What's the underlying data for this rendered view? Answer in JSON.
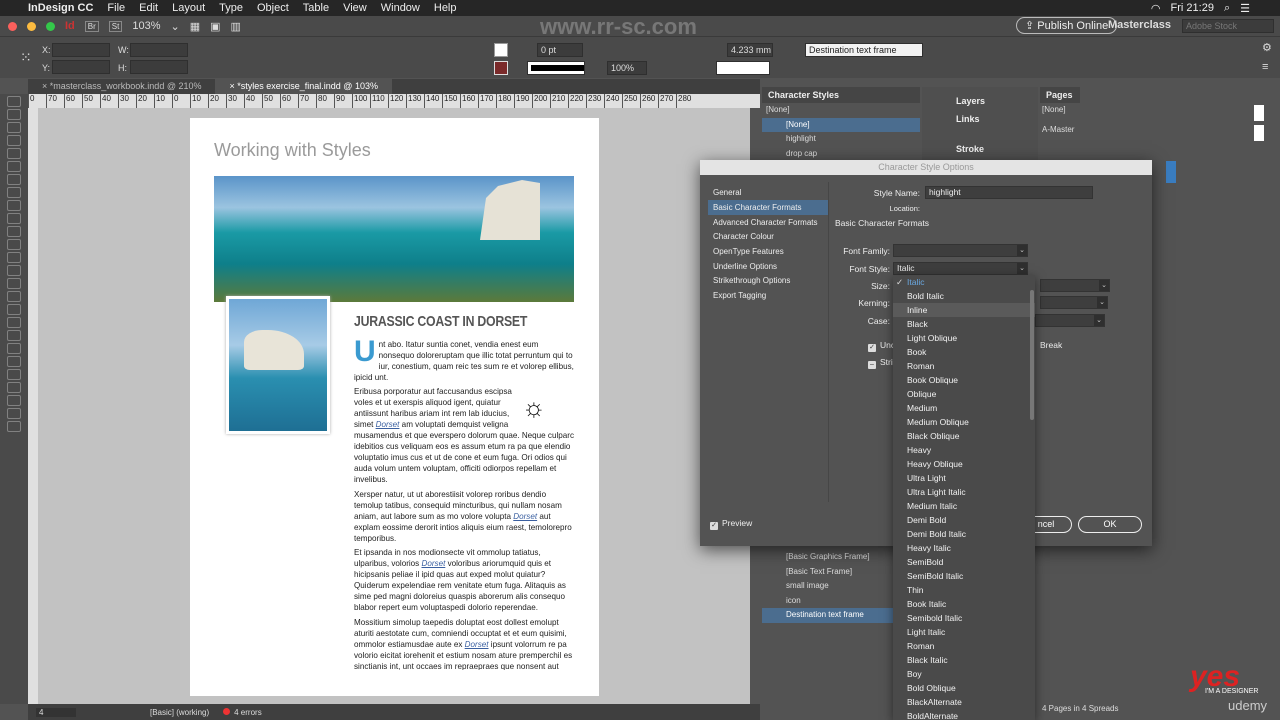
{
  "menubar": {
    "app": "InDesign CC",
    "items": [
      "File",
      "Edit",
      "Layout",
      "Type",
      "Object",
      "Table",
      "View",
      "Window",
      "Help"
    ],
    "clock": "Fri 21:29"
  },
  "appbar": {
    "zoom": "103%",
    "publish": "Publish Online",
    "workspace": "Masterclass",
    "stock_placeholder": "Adobe Stock"
  },
  "control": {
    "x_label": "X:",
    "y_label": "Y:",
    "w_label": "W:",
    "h_label": "H:",
    "stroke_weight": "0 pt",
    "opacity": "100%",
    "spacing": "4.233 mm",
    "object_style": "Destination text frame"
  },
  "tabs": [
    {
      "label": "*masterclass_workbook.indd @ 210%"
    },
    {
      "label": "*styles exercise_final.indd @ 103%"
    }
  ],
  "ruler": [
    "0",
    "70",
    "60",
    "50",
    "40",
    "30",
    "20",
    "10",
    "0",
    "10",
    "20",
    "30",
    "40",
    "50",
    "60",
    "70",
    "80",
    "90",
    "100",
    "110",
    "120",
    "130",
    "140",
    "150",
    "160",
    "170",
    "180",
    "190",
    "200",
    "210",
    "220",
    "230",
    "240",
    "250",
    "260",
    "270",
    "280"
  ],
  "document": {
    "title": "Working with Styles",
    "heading": "JURASSIC COAST IN DORSET",
    "dropcap": "U",
    "p1": "nt abo. Itatur suntia conet, vendia enest eum nonsequo doloreruptam que illic totat perruntum qui to iur, conestium, quam reic tes sum re et volorep ellibus, ipicid unt.",
    "p2a": "Eribusa porporatur aut faccusandus escipsa voles et ut exerspis aliquod igent, quiatur antiissunt haribus ariam int rem lab iducius, simet ",
    "p2b": " am voluptati demquist veligna musamendus et que everspero dolorum quae. Neque culparc idebitios cus veliquam eos es assum etum ra pa que elendio voluptatio imus cus et ut de cone et eum fuga. Ori odios qui auda volum untem voluptam, officiti odiorpos repellam et invelibus.",
    "p3a": "Xersper natur, ut ut aborestiisit volorep roribus dendio temolup tatibus, consequid mincturibus, qui nullam nosam aniam, aut labore sum as mo volore volupta ",
    "p3b": " aut explam eossime derorit intios aliquis eium raest, temolorepro temporibus.",
    "p4a": "Et ipsanda in nos modionsecte vit ommolup tatiatus, ulparibus, volorios ",
    "p4b": " voloribus ariorumquid quis et hicipsanis peliae il ipid quas aut exped molut quiatur? Quiderum expelendiae rem venitate etum fuga. Alitaquis as sime ped magni doloreius quaspis aborerum alis consequo blabor repert eum voluptaspedi dolorio reperendae.",
    "p5a": "Mossitium simolup taepedis doluptat eost dollest emolupt aturiti aestotate cum, comniendi occuptat et et eum quisimi, ommolor estiamusdae aute ex ",
    "p5b": " ipsunt volorrum re pa volorio eicitat iorehenit et estium nosam ature premperchil es sinctianis int, unt occaes im repraepraes que nonsent aut",
    "link": "Dorset"
  },
  "status": {
    "page": "4",
    "style": "[Basic] (working)",
    "errors": "4 errors"
  },
  "character_styles": {
    "title": "Character Styles",
    "current": "[None]",
    "items": [
      "[None]",
      "highlight",
      "drop cap"
    ]
  },
  "object_styles": {
    "items": [
      "[Basic Graphics Frame]",
      "[Basic Text Frame]",
      "small image",
      "icon",
      "Destination text frame"
    ]
  },
  "mid_panel": {
    "items": [
      "Layers",
      "Links",
      "Stroke"
    ]
  },
  "pages": {
    "title": "Pages",
    "items": [
      "[None]",
      "A-Master"
    ],
    "footer": "4 Pages in 4 Spreads"
  },
  "dialog": {
    "title": "Character Style Options",
    "nav": [
      "General",
      "Basic Character Formats",
      "Advanced Character Formats",
      "Character Colour",
      "OpenType Features",
      "Underline Options",
      "Strikethrough Options",
      "Export Tagging"
    ],
    "style_name_label": "Style Name:",
    "style_name": "highlight",
    "location_label": "Location:",
    "section": "Basic Character Formats",
    "font_family_label": "Font Family:",
    "font_style_label": "Font Style:",
    "font_style": "Italic",
    "size_label": "Size:",
    "kerning_label": "Kerning:",
    "case_label": "Case:",
    "underline": "Unc",
    "strike": "Stri",
    "break": "Break",
    "preview": "Preview",
    "cancel": "ncel",
    "ok": "OK"
  },
  "font_style_menu": [
    "Italic",
    "Bold Italic",
    "Inline",
    "Black",
    "Light Oblique",
    "Book",
    "Roman",
    "Book Oblique",
    "Oblique",
    "Medium",
    "Medium Oblique",
    "Black Oblique",
    "Heavy",
    "Heavy Oblique",
    "Ultra Light",
    "Ultra Light Italic",
    "Medium Italic",
    "Demi Bold",
    "Demi Bold Italic",
    "Heavy Italic",
    "SemiBold",
    "SemiBold Italic",
    "Thin",
    "Book Italic",
    "Semibold Italic",
    "Light Italic",
    "Roman",
    "Black Italic",
    "Boy",
    "Bold Oblique",
    "BlackAlternate",
    "BoldAlternate"
  ],
  "watermark": "www.rr-sc.com",
  "branding": {
    "yes": "yes",
    "tag": "I'M A DESIGNER",
    "udemy": "udemy"
  },
  "colors": {
    "accent": "#4b6d8f",
    "dropcap": "#3a9ad0",
    "link": "#3a5fa0"
  }
}
